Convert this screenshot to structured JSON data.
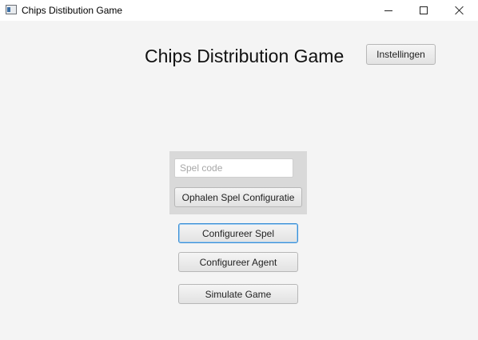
{
  "window": {
    "title": "Chips Distibution Game",
    "icon": "app-window-icon",
    "controls": {
      "minimize": "minimize-icon",
      "maximize": "maximize-icon",
      "close": "close-icon"
    }
  },
  "main": {
    "heading": "Chips Distribution Game",
    "settings_label": "Instellingen",
    "game_code_placeholder": "Spel code",
    "game_code_value": "",
    "fetch_config_label": "Ophalen Spel Configuratie",
    "configure_game_label": "Configureer Spel",
    "configure_agent_label": "Configureer Agent",
    "simulate_game_label": "Simulate Game"
  },
  "colors": {
    "background": "#f4f4f4",
    "panel": "#d9d9d9",
    "focus_border": "#3a8fd6"
  }
}
